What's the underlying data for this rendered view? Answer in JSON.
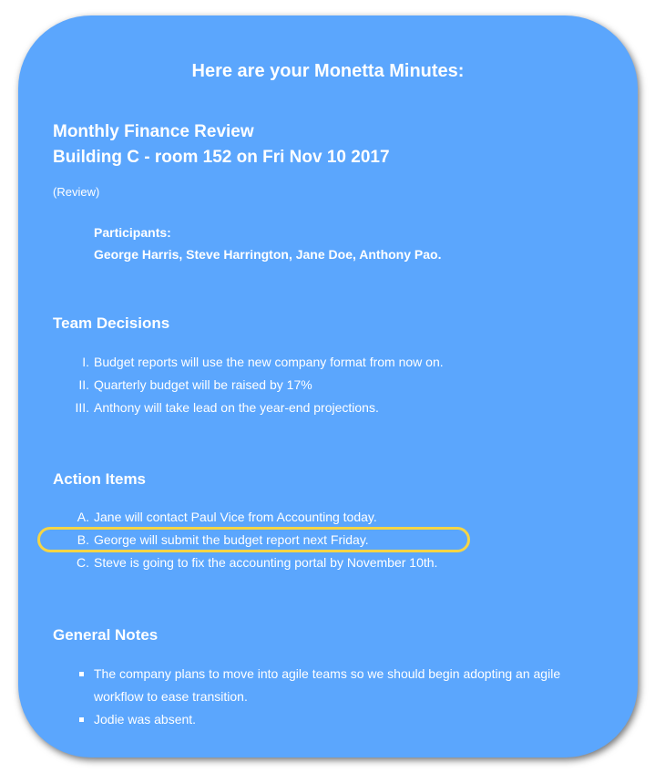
{
  "header": {
    "title": "Here are your Monetta Minutes:"
  },
  "meeting": {
    "title": "Monthly Finance Review",
    "location_date": "Building C - room 152 on Fri Nov 10 2017",
    "type": "(Review)",
    "participants_label": "Participants:",
    "participants": "George Harris, Steve Harrington, Jane Doe, Anthony Pao."
  },
  "decisions": {
    "heading": "Team Decisions",
    "items": [
      {
        "marker": "I.",
        "text": "Budget reports will use the new company format from now on."
      },
      {
        "marker": "II.",
        "text": "Quarterly budget will be raised by 17%"
      },
      {
        "marker": "III.",
        "text": "Anthony will take lead on the year-end projections."
      }
    ]
  },
  "actions": {
    "heading": "Action Items",
    "items": [
      {
        "marker": "A.",
        "text": "Jane will contact Paul Vice from Accounting today."
      },
      {
        "marker": "B.",
        "text": "George will submit the budget report next Friday."
      },
      {
        "marker": "C.",
        "text": "Steve is going to fix the accounting portal by November 10th."
      }
    ]
  },
  "notes": {
    "heading": "General Notes",
    "items": [
      {
        "text": "The company plans to move into agile teams so we should begin adopting an agile workflow to ease transition."
      },
      {
        "text": "Jodie was absent."
      }
    ]
  },
  "colors": {
    "card_background": "#5ba6fd",
    "text": "#ffffff",
    "highlight": "#f5d545"
  }
}
